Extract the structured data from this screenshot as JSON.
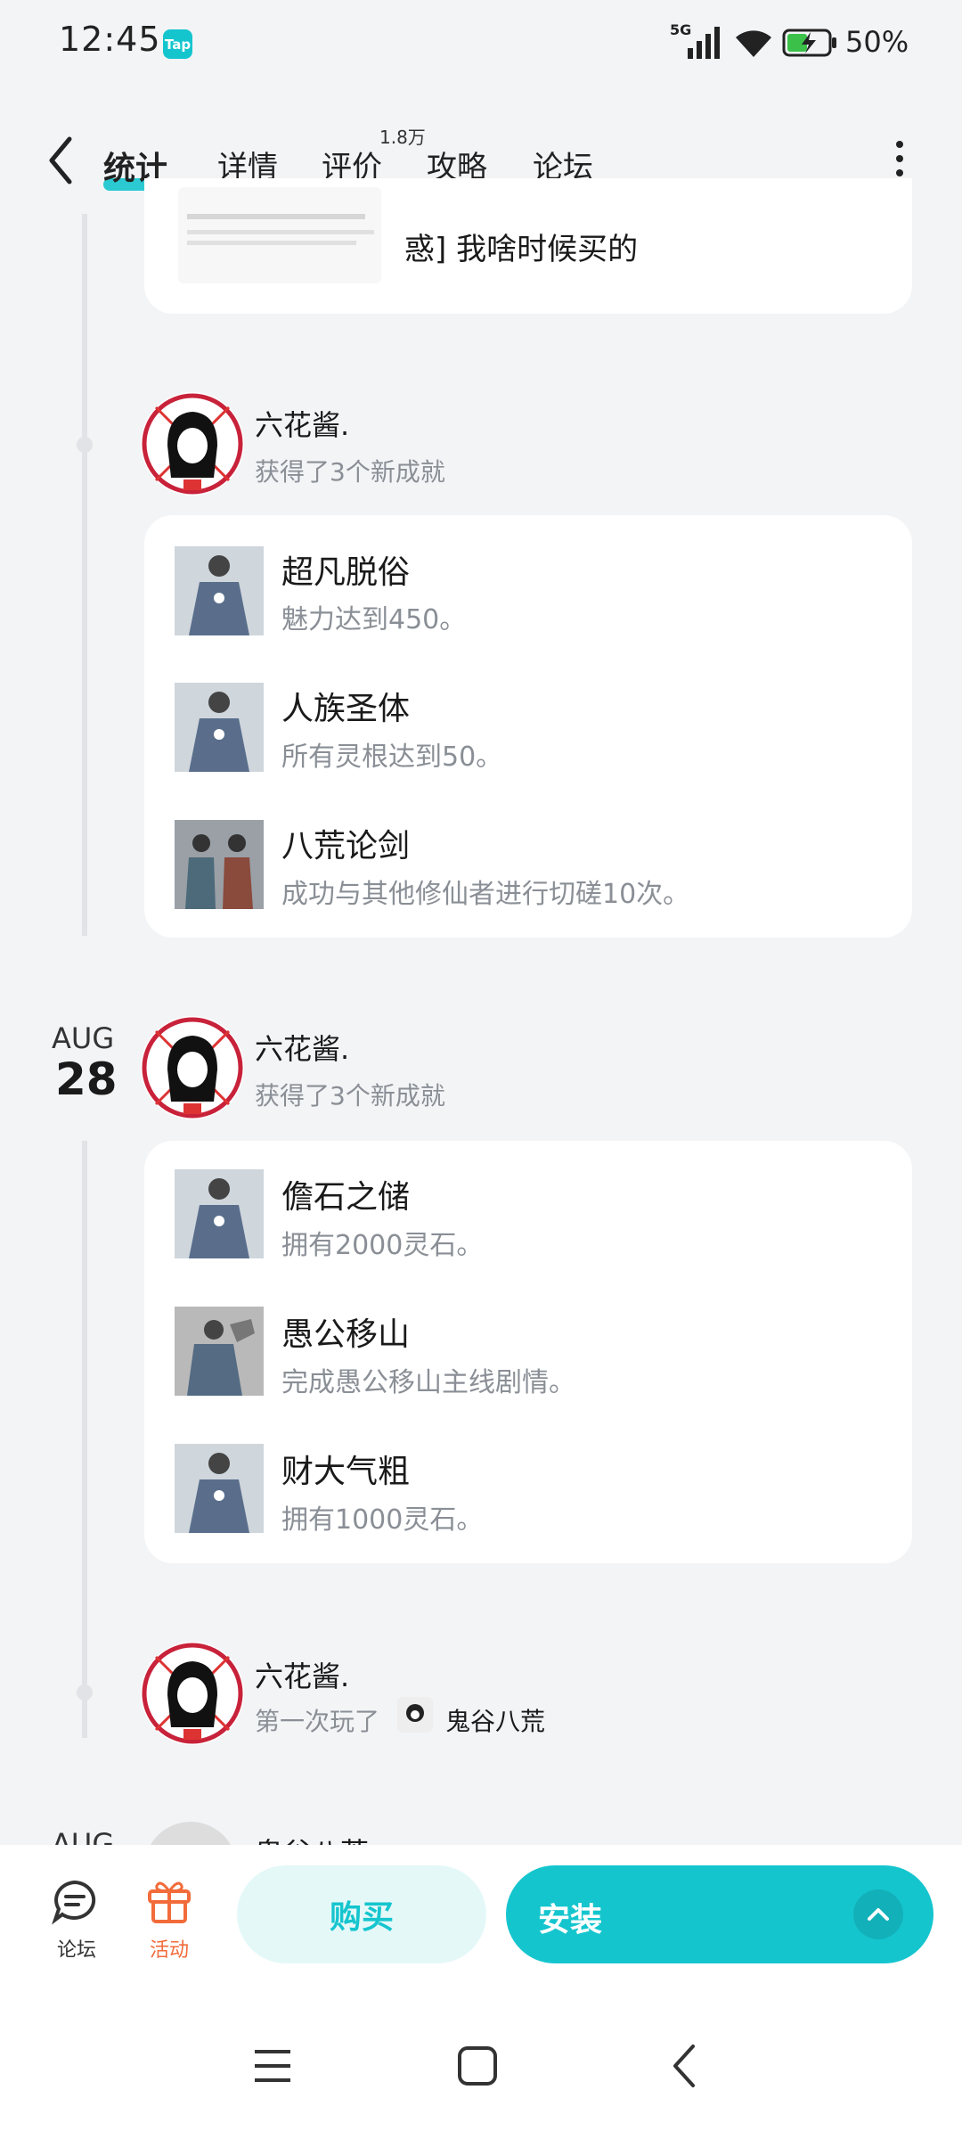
{
  "status_bar": {
    "time": "12:45",
    "app_badge": "Tap",
    "network": "5G",
    "battery": "50%"
  },
  "nav": {
    "tabs": [
      {
        "label": "统计",
        "active": true
      },
      {
        "label": "详情"
      },
      {
        "label": "评价",
        "badge": "1.8万"
      },
      {
        "label": "攻略"
      },
      {
        "label": "论坛"
      }
    ]
  },
  "top_card": {
    "text": "惑] 我啥时候买的"
  },
  "feed": [
    {
      "user": "六花酱.",
      "action": "获得了3个新成就",
      "achievements": [
        {
          "title": "超凡脱俗",
          "desc": "魅力达到450。"
        },
        {
          "title": "人族圣体",
          "desc": "所有灵根达到50。"
        },
        {
          "title": "八荒论剑",
          "desc": "成功与其他修仙者进行切磋10次。"
        }
      ]
    },
    {
      "date_month": "AUG",
      "date_day": "28",
      "user": "六花酱.",
      "action": "获得了3个新成就",
      "achievements": [
        {
          "title": "儋石之储",
          "desc": "拥有2000灵石。"
        },
        {
          "title": "愚公移山",
          "desc": "完成愚公移山主线剧情。"
        },
        {
          "title": "财大气粗",
          "desc": "拥有1000灵石。"
        }
      ]
    },
    {
      "user": "六花酱.",
      "action": "第一次玩了",
      "game": "鬼谷八荒"
    },
    {
      "date_month": "AUG",
      "user": "鬼谷八荒"
    }
  ],
  "bottom_bar": {
    "forum_label": "论坛",
    "activity_label": "活动",
    "buy_label": "购买",
    "install_label": "安装"
  },
  "colors": {
    "accent": "#15c5ce",
    "activity": "#f26b3a",
    "bg": "#f3f4f6"
  }
}
